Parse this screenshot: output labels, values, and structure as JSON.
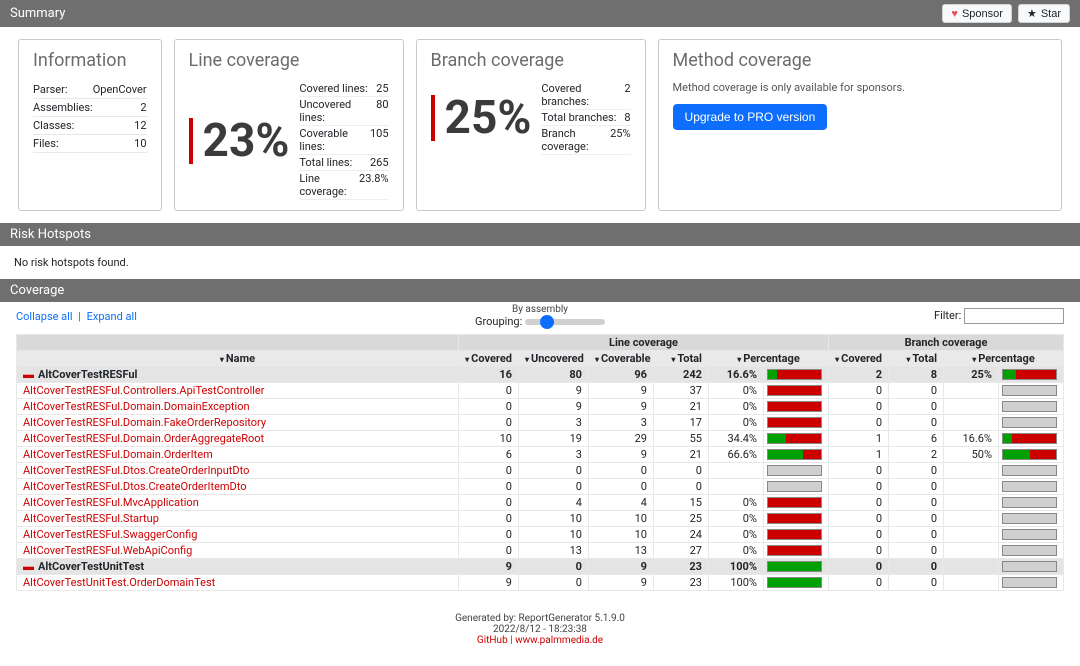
{
  "header": {
    "title": "Summary",
    "sponsor": "Sponsor",
    "star": "Star"
  },
  "info": {
    "title": "Information",
    "rows": [
      {
        "k": "Parser:",
        "v": "OpenCover"
      },
      {
        "k": "Assemblies:",
        "v": "2"
      },
      {
        "k": "Classes:",
        "v": "12"
      },
      {
        "k": "Files:",
        "v": "10"
      }
    ]
  },
  "line_cov": {
    "title": "Line coverage",
    "pct": "23%",
    "stats": [
      {
        "k": "Covered lines:",
        "v": "25"
      },
      {
        "k": "Uncovered lines:",
        "v": "80"
      },
      {
        "k": "Coverable lines:",
        "v": "105"
      },
      {
        "k": "Total lines:",
        "v": "265"
      },
      {
        "k": "Line coverage:",
        "v": "23.8%"
      }
    ]
  },
  "branch_cov": {
    "title": "Branch coverage",
    "pct": "25%",
    "stats": [
      {
        "k": "Covered branches:",
        "v": "2"
      },
      {
        "k": "Total branches:",
        "v": "8"
      },
      {
        "k": "Branch coverage:",
        "v": "25%"
      }
    ]
  },
  "method_cov": {
    "title": "Method coverage",
    "text": "Method coverage is only available for sponsors.",
    "btn": "Upgrade to PRO version"
  },
  "hotspots": {
    "title": "Risk Hotspots",
    "text": "No risk hotspots found."
  },
  "coverage_section": "Coverage",
  "controls": {
    "collapse": "Collapse all",
    "expand": "Expand all",
    "by_assembly": "By assembly",
    "grouping": "Grouping:",
    "filter": "Filter:"
  },
  "columns": {
    "name": "Name",
    "line_group": "Line coverage",
    "branch_group": "Branch coverage",
    "covered": "Covered",
    "uncovered": "Uncovered",
    "coverable": "Coverable",
    "total": "Total",
    "percentage": "Percentage"
  },
  "rows": [
    {
      "type": "asm",
      "name": "AltCoverTestRESFul",
      "covered": "16",
      "uncovered": "80",
      "coverable": "96",
      "total": "242",
      "lpct": "16.6%",
      "lbar": [
        16.6,
        83.4,
        0
      ],
      "bcov": "2",
      "btot": "8",
      "bpct": "25%",
      "bbar": [
        25,
        75,
        0
      ]
    },
    {
      "type": "cls",
      "name": "AltCoverTestRESFul.Controllers.ApiTestController",
      "covered": "0",
      "uncovered": "9",
      "coverable": "9",
      "total": "37",
      "lpct": "0%",
      "lbar": [
        0,
        100,
        0
      ],
      "bcov": "0",
      "btot": "0",
      "bpct": "",
      "bbar": null
    },
    {
      "type": "cls",
      "name": "AltCoverTestRESFul.Domain.DomainException",
      "covered": "0",
      "uncovered": "9",
      "coverable": "9",
      "total": "21",
      "lpct": "0%",
      "lbar": [
        0,
        100,
        0
      ],
      "bcov": "0",
      "btot": "0",
      "bpct": "",
      "bbar": null
    },
    {
      "type": "cls",
      "name": "AltCoverTestRESFul.Domain.FakeOrderRepository",
      "covered": "0",
      "uncovered": "3",
      "coverable": "3",
      "total": "17",
      "lpct": "0%",
      "lbar": [
        0,
        100,
        0
      ],
      "bcov": "0",
      "btot": "0",
      "bpct": "",
      "bbar": null
    },
    {
      "type": "cls",
      "name": "AltCoverTestRESFul.Domain.OrderAggregateRoot",
      "covered": "10",
      "uncovered": "19",
      "coverable": "29",
      "total": "55",
      "lpct": "34.4%",
      "lbar": [
        34.4,
        65.6,
        0
      ],
      "bcov": "1",
      "btot": "6",
      "bpct": "16.6%",
      "bbar": [
        16.6,
        83.4,
        0
      ]
    },
    {
      "type": "cls",
      "name": "AltCoverTestRESFul.Domain.OrderItem",
      "covered": "6",
      "uncovered": "3",
      "coverable": "9",
      "total": "21",
      "lpct": "66.6%",
      "lbar": [
        66.6,
        33.4,
        0
      ],
      "bcov": "1",
      "btot": "2",
      "bpct": "50%",
      "bbar": [
        50,
        50,
        0
      ]
    },
    {
      "type": "cls",
      "name": "AltCoverTestRESFul.Dtos.CreateOrderInputDto",
      "covered": "0",
      "uncovered": "0",
      "coverable": "0",
      "total": "0",
      "lpct": "",
      "lbar": null,
      "bcov": "0",
      "btot": "0",
      "bpct": "",
      "bbar": null
    },
    {
      "type": "cls",
      "name": "AltCoverTestRESFul.Dtos.CreateOrderItemDto",
      "covered": "0",
      "uncovered": "0",
      "coverable": "0",
      "total": "0",
      "lpct": "",
      "lbar": null,
      "bcov": "0",
      "btot": "0",
      "bpct": "",
      "bbar": null
    },
    {
      "type": "cls",
      "name": "AltCoverTestRESFul.MvcApplication",
      "covered": "0",
      "uncovered": "4",
      "coverable": "4",
      "total": "15",
      "lpct": "0%",
      "lbar": [
        0,
        100,
        0
      ],
      "bcov": "0",
      "btot": "0",
      "bpct": "",
      "bbar": null
    },
    {
      "type": "cls",
      "name": "AltCoverTestRESFul.Startup",
      "covered": "0",
      "uncovered": "10",
      "coverable": "10",
      "total": "25",
      "lpct": "0%",
      "lbar": [
        0,
        100,
        0
      ],
      "bcov": "0",
      "btot": "0",
      "bpct": "",
      "bbar": null
    },
    {
      "type": "cls",
      "name": "AltCoverTestRESFul.SwaggerConfig",
      "covered": "0",
      "uncovered": "10",
      "coverable": "10",
      "total": "24",
      "lpct": "0%",
      "lbar": [
        0,
        100,
        0
      ],
      "bcov": "0",
      "btot": "0",
      "bpct": "",
      "bbar": null
    },
    {
      "type": "cls",
      "name": "AltCoverTestRESFul.WebApiConfig",
      "covered": "0",
      "uncovered": "13",
      "coverable": "13",
      "total": "27",
      "lpct": "0%",
      "lbar": [
        0,
        100,
        0
      ],
      "bcov": "0",
      "btot": "0",
      "bpct": "",
      "bbar": null
    },
    {
      "type": "asm",
      "name": "AltCoverTestUnitTest",
      "covered": "9",
      "uncovered": "0",
      "coverable": "9",
      "total": "23",
      "lpct": "100%",
      "lbar": [
        100,
        0,
        0
      ],
      "bcov": "0",
      "btot": "0",
      "bpct": "",
      "bbar": null
    },
    {
      "type": "cls",
      "name": "AltCoverTestUnitTest.OrderDomainTest",
      "covered": "9",
      "uncovered": "0",
      "coverable": "9",
      "total": "23",
      "lpct": "100%",
      "lbar": [
        100,
        0,
        0
      ],
      "bcov": "0",
      "btot": "0",
      "bpct": "",
      "bbar": null
    }
  ],
  "footer": {
    "gen": "Generated by: ReportGenerator 5.1.9.0",
    "ts": "2022/8/12 - 18:23:38",
    "gh": "GitHub",
    "site": "www.palmmedia.de"
  }
}
